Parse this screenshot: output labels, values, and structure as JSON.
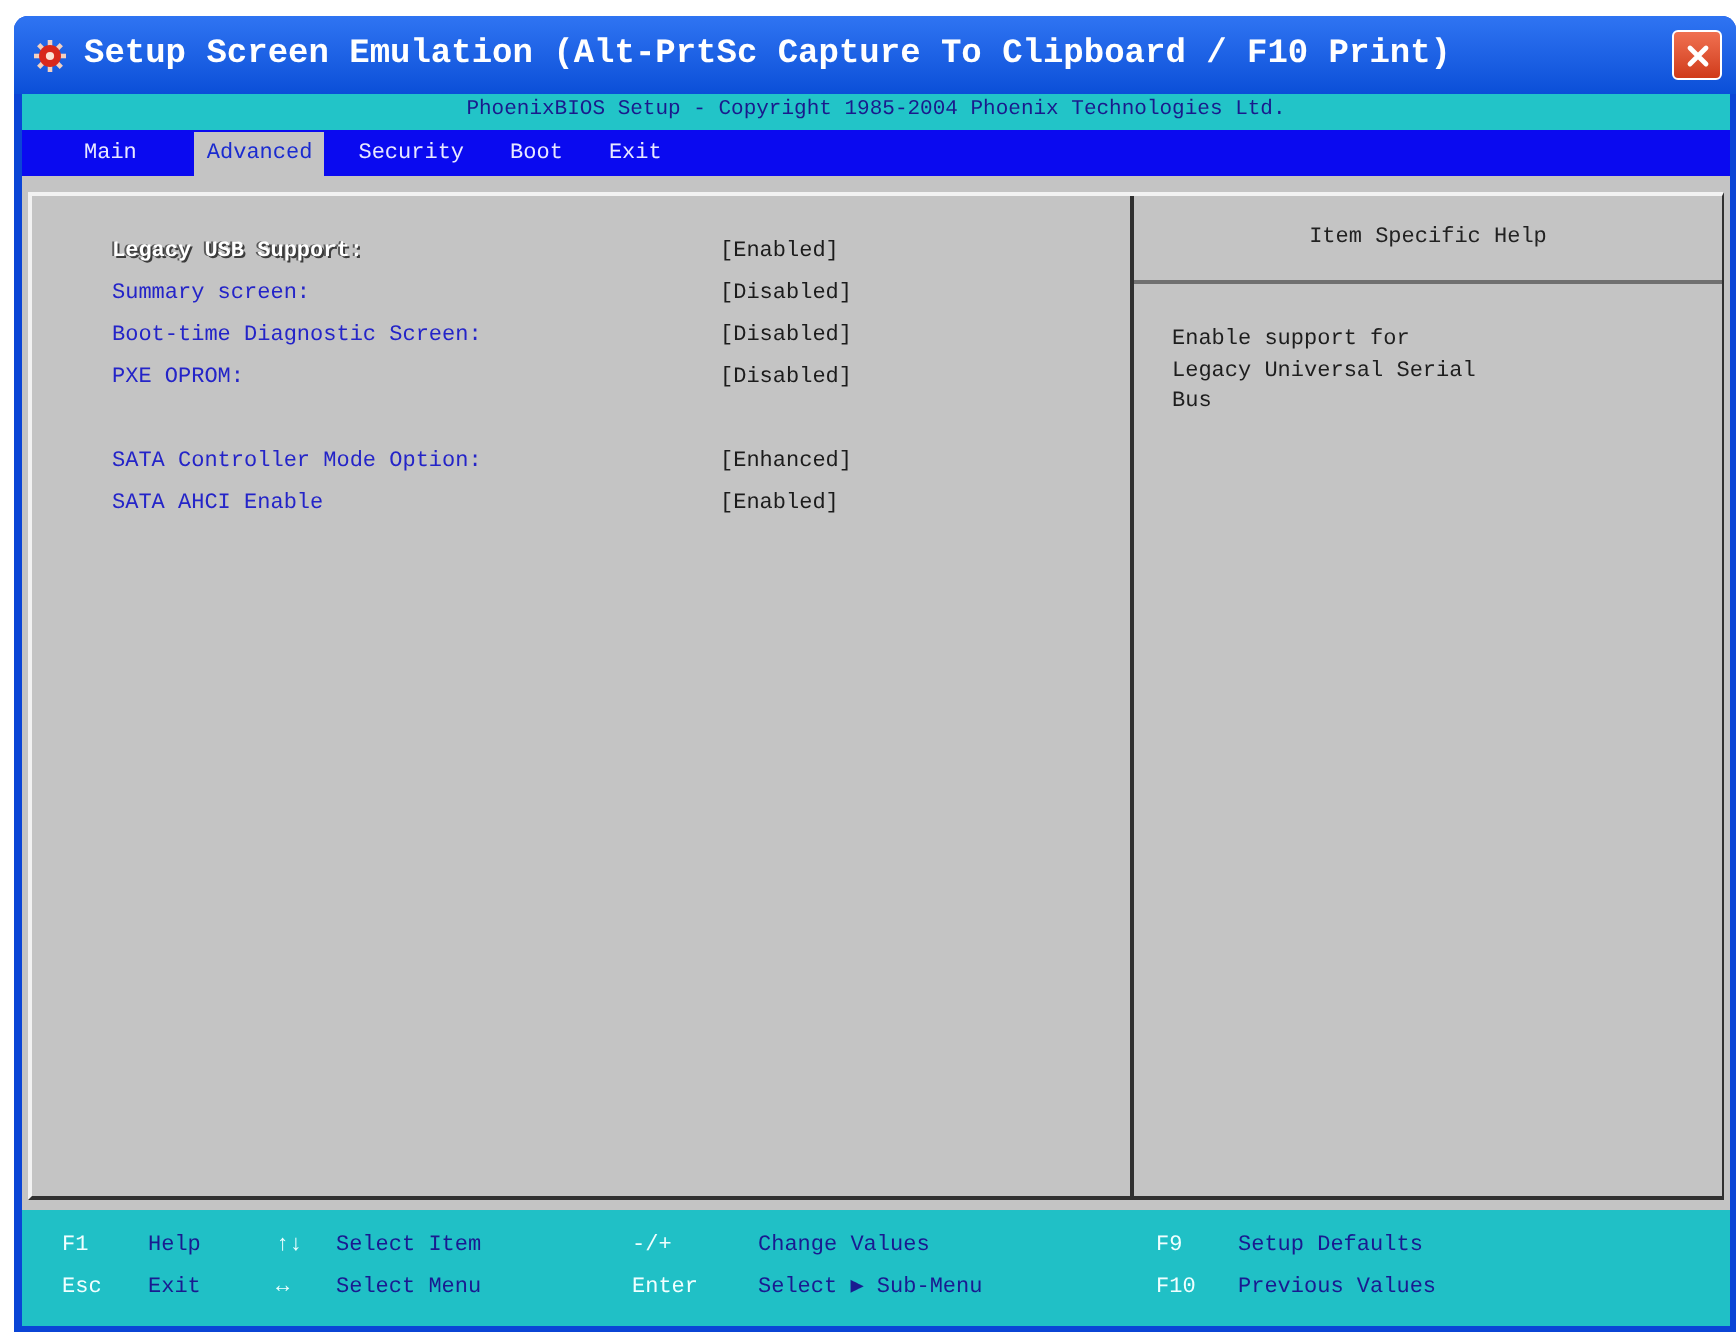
{
  "window": {
    "title": "Setup Screen Emulation (Alt-PrtSc Capture To Clipboard / F10 Print)"
  },
  "banner": "PhoenixBIOS Setup - Copyright 1985-2004 Phoenix Technologies Ltd.",
  "tabs": [
    {
      "label": "Main",
      "selected": false
    },
    {
      "label": "Advanced",
      "selected": true
    },
    {
      "label": "Security",
      "selected": false
    },
    {
      "label": "Boot",
      "selected": false
    },
    {
      "label": "Exit",
      "selected": false
    }
  ],
  "settings": {
    "groups": [
      [
        {
          "label": "Legacy USB Support:",
          "value": "[Enabled]",
          "selected": true
        },
        {
          "label": "Summary screen:",
          "value": "[Disabled]",
          "selected": false
        },
        {
          "label": "Boot-time Diagnostic Screen:",
          "value": "[Disabled]",
          "selected": false
        },
        {
          "label": "PXE OPROM:",
          "value": "[Disabled]",
          "selected": false
        }
      ],
      [
        {
          "label": "SATA Controller Mode Option:",
          "value": "[Enhanced]",
          "selected": false
        },
        {
          "label": "SATA AHCI Enable",
          "value": "[Enabled]",
          "selected": false
        }
      ]
    ]
  },
  "help": {
    "title": "Item Specific Help",
    "text": "Enable support for\nLegacy Universal Serial\nBus"
  },
  "footer": {
    "rows": [
      [
        {
          "key": "F1",
          "action": "Help"
        },
        {
          "key": "↑↓",
          "action": "Select Item"
        },
        {
          "key": "-/+",
          "action": "Change Values"
        },
        {
          "key": "F9",
          "action": "Setup Defaults"
        }
      ],
      [
        {
          "key": "Esc",
          "action": "Exit"
        },
        {
          "key": "↔",
          "action": "Select Menu"
        },
        {
          "key": "Enter",
          "action": "Select ▶ Sub-Menu"
        },
        {
          "key": "F10",
          "action": "Previous Values"
        }
      ]
    ]
  }
}
